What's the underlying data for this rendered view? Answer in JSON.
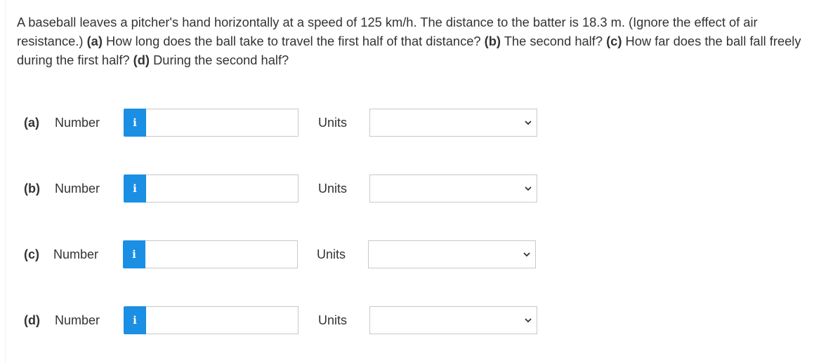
{
  "question": {
    "intro": "A baseball leaves a pitcher's hand horizontally at a speed of 125 km/h. The distance to the batter is 18.3 m. (Ignore the effect of air resistance.)",
    "part_a_tag": "(a)",
    "part_a_text": "How long does the ball take to travel the first half of that distance?",
    "part_b_tag": "(b)",
    "part_b_text": "The second half?",
    "part_c_tag": "(c)",
    "part_c_text": "How far does the ball fall freely during the first half?",
    "part_d_tag": "(d)",
    "part_d_text": "During the second half?"
  },
  "rows": [
    {
      "part": "(a)",
      "number_label": "Number",
      "info_icon": "i",
      "number_value": "",
      "units_label": "Units",
      "units_value": ""
    },
    {
      "part": "(b)",
      "number_label": "Number",
      "info_icon": "i",
      "number_value": "",
      "units_label": "Units",
      "units_value": ""
    },
    {
      "part": "(c)",
      "number_label": "Number",
      "info_icon": "i",
      "number_value": "",
      "units_label": "Units",
      "units_value": ""
    },
    {
      "part": "(d)",
      "number_label": "Number",
      "info_icon": "i",
      "number_value": "",
      "units_label": "Units",
      "units_value": ""
    }
  ],
  "icons": {
    "info": "info-icon",
    "dropdown": "chevron-down-icon"
  },
  "colors": {
    "info_button": "#1a8fe3",
    "text": "#333333",
    "input_border": "#c8c8c8"
  }
}
